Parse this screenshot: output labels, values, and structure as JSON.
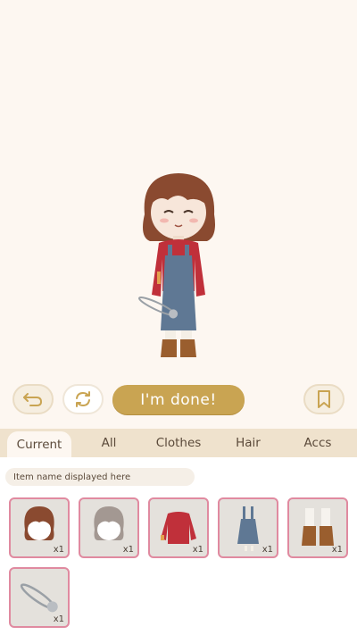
{
  "controls": {
    "undo_icon": "undo-arrow-icon",
    "shuffle_icon": "refresh-cycle-icon",
    "done_label": "I'm done!",
    "bookmark_icon": "bookmark-icon"
  },
  "tabs": [
    {
      "label": "Current",
      "active": true
    },
    {
      "label": "All",
      "active": false
    },
    {
      "label": "Clothes",
      "active": false
    },
    {
      "label": "Hair",
      "active": false
    },
    {
      "label": "Accs",
      "active": false
    }
  ],
  "item_name_placeholder": "Item name displayed here",
  "items": [
    {
      "name": "bob-hair-brown",
      "qty": "x1"
    },
    {
      "name": "bob-hair-gray",
      "qty": "x1"
    },
    {
      "name": "red-sweater",
      "qty": "x1"
    },
    {
      "name": "denim-overalls",
      "qty": "x1"
    },
    {
      "name": "brown-lace-boots",
      "qty": "x1"
    },
    {
      "name": "safety-pin",
      "qty": "x1"
    }
  ],
  "colors": {
    "accent_gold": "#c9a452",
    "selected_border": "#e08aa0",
    "tab_bar": "#efe2cd"
  }
}
